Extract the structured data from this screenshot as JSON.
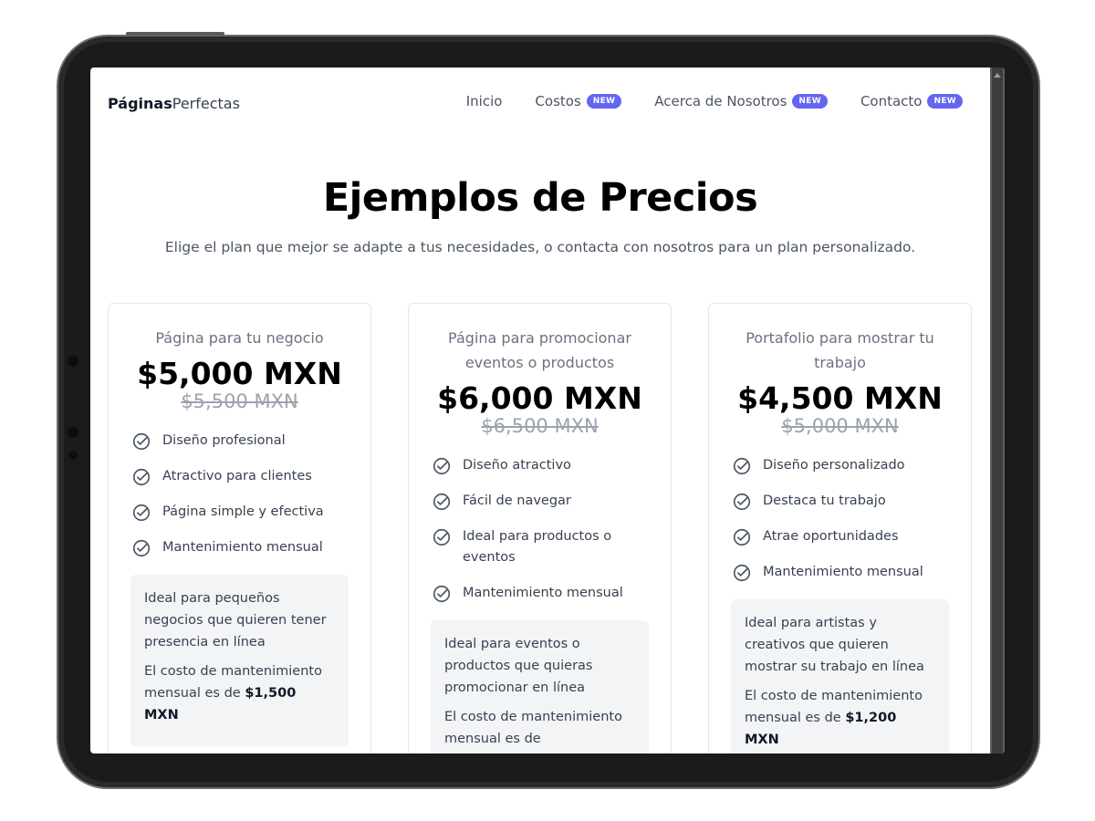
{
  "nav": {
    "brand_bold": "Páginas",
    "brand_rest": "Perfectas",
    "items": [
      {
        "label": "Inicio",
        "badge": ""
      },
      {
        "label": "Costos",
        "badge": "NEW"
      },
      {
        "label": "Acerca de Nosotros",
        "badge": "NEW"
      },
      {
        "label": "Contacto",
        "badge": "NEW"
      }
    ]
  },
  "hero": {
    "title": "Ejemplos de Precios",
    "subtitle": "Elige el plan que mejor se adapte a tus necesidades, o contacta con nosotros para un plan personalizado."
  },
  "plans": [
    {
      "name": "Página para tu negocio",
      "price": "$5,000 MXN",
      "old_price": "$5,500 MXN",
      "features": [
        "Diseño profesional",
        "Atractivo para clientes",
        "Página simple y efectiva",
        "Mantenimiento mensual"
      ],
      "note": "Ideal para pequeños negocios que quieren tener presencia en línea",
      "maint_prefix": "El costo de mantenimiento mensual es de ",
      "maint_amount": "$1,500 MXN"
    },
    {
      "name": "Página para promocionar eventos o productos",
      "price": "$6,000 MXN",
      "old_price": "$6,500 MXN",
      "features": [
        "Diseño atractivo",
        "Fácil de navegar",
        "Ideal para productos o eventos",
        "Mantenimiento mensual"
      ],
      "note": "Ideal para eventos o productos que quieras promocionar en línea",
      "maint_prefix": "El costo de mantenimiento mensual es de ",
      "maint_amount": ""
    },
    {
      "name": "Portafolio para mostrar tu trabajo",
      "price": "$4,500 MXN",
      "old_price": "$5,000 MXN",
      "features": [
        "Diseño personalizado",
        "Destaca tu trabajo",
        "Atrae oportunidades",
        "Mantenimiento mensual"
      ],
      "note": "Ideal para artistas y creativos que quieren mostrar su trabajo en línea",
      "maint_prefix": "El costo de mantenimiento mensual es de ",
      "maint_amount": "$1,200 MXN"
    }
  ],
  "colors": {
    "accent": "#6366f1",
    "text_dark": "#111827",
    "muted": "#6b7280"
  },
  "icons": {
    "feature": "check-circle-icon"
  }
}
